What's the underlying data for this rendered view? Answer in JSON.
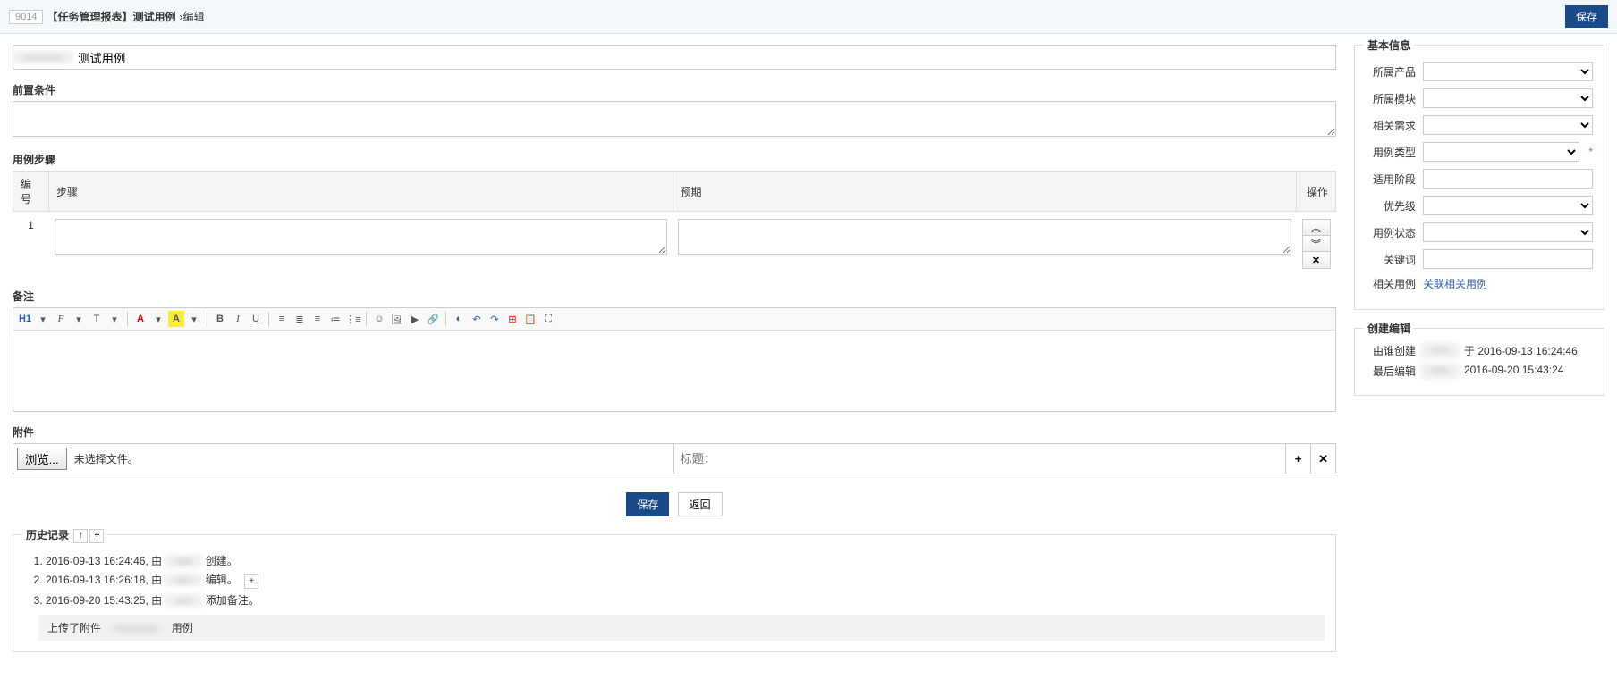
{
  "header": {
    "id": "9014",
    "title": "【任务管理报表】测试用例",
    "crumb": "›编辑",
    "save": "保存"
  },
  "form": {
    "title_value": "测试用例",
    "precondition_label": "前置条件",
    "steps_label": "用例步骤",
    "steps_headers": {
      "num": "编号",
      "step": "步骤",
      "expect": "预期",
      "op": "操作"
    },
    "steps": [
      {
        "num": "1",
        "step": "",
        "expect": ""
      }
    ],
    "remark_label": "备注",
    "attach_label": "附件",
    "browse_label": "浏览...",
    "no_file": "未选择文件。",
    "attach_title_placeholder": "标题：",
    "btn_save": "保存",
    "btn_back": "返回"
  },
  "toolbar": {
    "h": "H1",
    "font": "F",
    "size": "T",
    "color": "A",
    "bg": "A",
    "bold": "B",
    "italic": "I",
    "underline": "U"
  },
  "history": {
    "label": "历史记录",
    "items": [
      {
        "time": "2016-09-13 16:24:46",
        "action": "创建。"
      },
      {
        "time": "2016-09-13 16:26:18",
        "action": "编辑。",
        "expandable": true
      },
      {
        "time": "2016-09-20 15:43:25",
        "action": "添加备注。"
      }
    ],
    "sub_prefix": "上传了附件",
    "sub_suffix": "用例"
  },
  "side": {
    "basic_label": "基本信息",
    "fields": {
      "product": "所属产品",
      "module": "所属模块",
      "story": "相关需求",
      "type": "用例类型",
      "stage": "适用阶段",
      "priority": "优先级",
      "status": "用例状态",
      "keywords": "关键词",
      "linkcase": "相关用例"
    },
    "linkcase_link": "关联相关用例",
    "audit_label": "创建编辑",
    "created_by_label": "由谁创建",
    "created_time": "于 2016-09-13 16:24:46",
    "lastedit_label": "最后编辑",
    "lastedit_time": "2016-09-20 15:43:24"
  }
}
